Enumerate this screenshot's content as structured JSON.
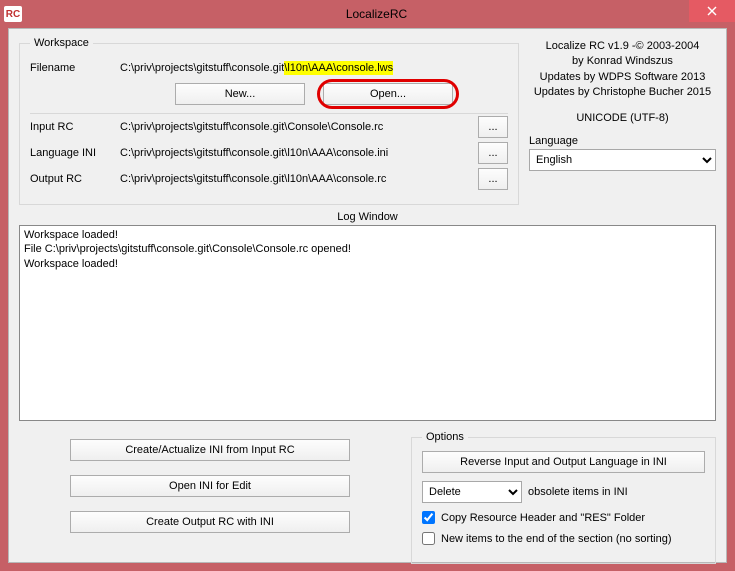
{
  "titlebar": {
    "app_icon_text": "RC",
    "title": "LocalizeRC"
  },
  "workspace": {
    "legend": "Workspace",
    "filename_label": "Filename",
    "filename_value_pre": "C:\\priv\\projects\\gitstuff\\console.git",
    "filename_value_hl": "\\l10n\\AAA\\console.lws",
    "new_btn": "New...",
    "open_btn": "Open...",
    "input_rc_label": "Input RC",
    "input_rc_value": "C:\\priv\\projects\\gitstuff\\console.git\\Console\\Console.rc",
    "language_ini_label": "Language INI",
    "language_ini_value": "C:\\priv\\projects\\gitstuff\\console.git\\l10n\\AAA\\console.ini",
    "output_rc_label": "Output RC",
    "output_rc_value": "C:\\priv\\projects\\gitstuff\\console.git\\l10n\\AAA\\console.rc",
    "dots": "..."
  },
  "info": {
    "line1": "Localize RC v1.9 -© 2003-2004",
    "line2": "by Konrad Windszus",
    "line3": "Updates by WDPS Software 2013",
    "line4": "Updates by Christophe Bucher 2015",
    "encoding": "UNICODE (UTF-8)",
    "lang_label": "Language",
    "lang_value": "English"
  },
  "log": {
    "label": "Log Window",
    "text": "Workspace loaded!\nFile C:\\priv\\projects\\gitstuff\\console.git\\Console\\Console.rc opened!\nWorkspace loaded!"
  },
  "actions": {
    "create_ini": "Create/Actualize INI from Input RC",
    "open_ini": "Open INI for Edit",
    "create_rc": "Create Output RC with INI"
  },
  "options": {
    "legend": "Options",
    "reverse_btn": "Reverse Input and Output Language in INI",
    "delete_value": "Delete",
    "obsolete_text": "obsolete items in INI",
    "copy_header_label": "Copy Resource Header and \"RES\" Folder",
    "copy_header_checked": true,
    "new_items_label": "New items to the end of the section (no sorting)",
    "new_items_checked": false
  }
}
